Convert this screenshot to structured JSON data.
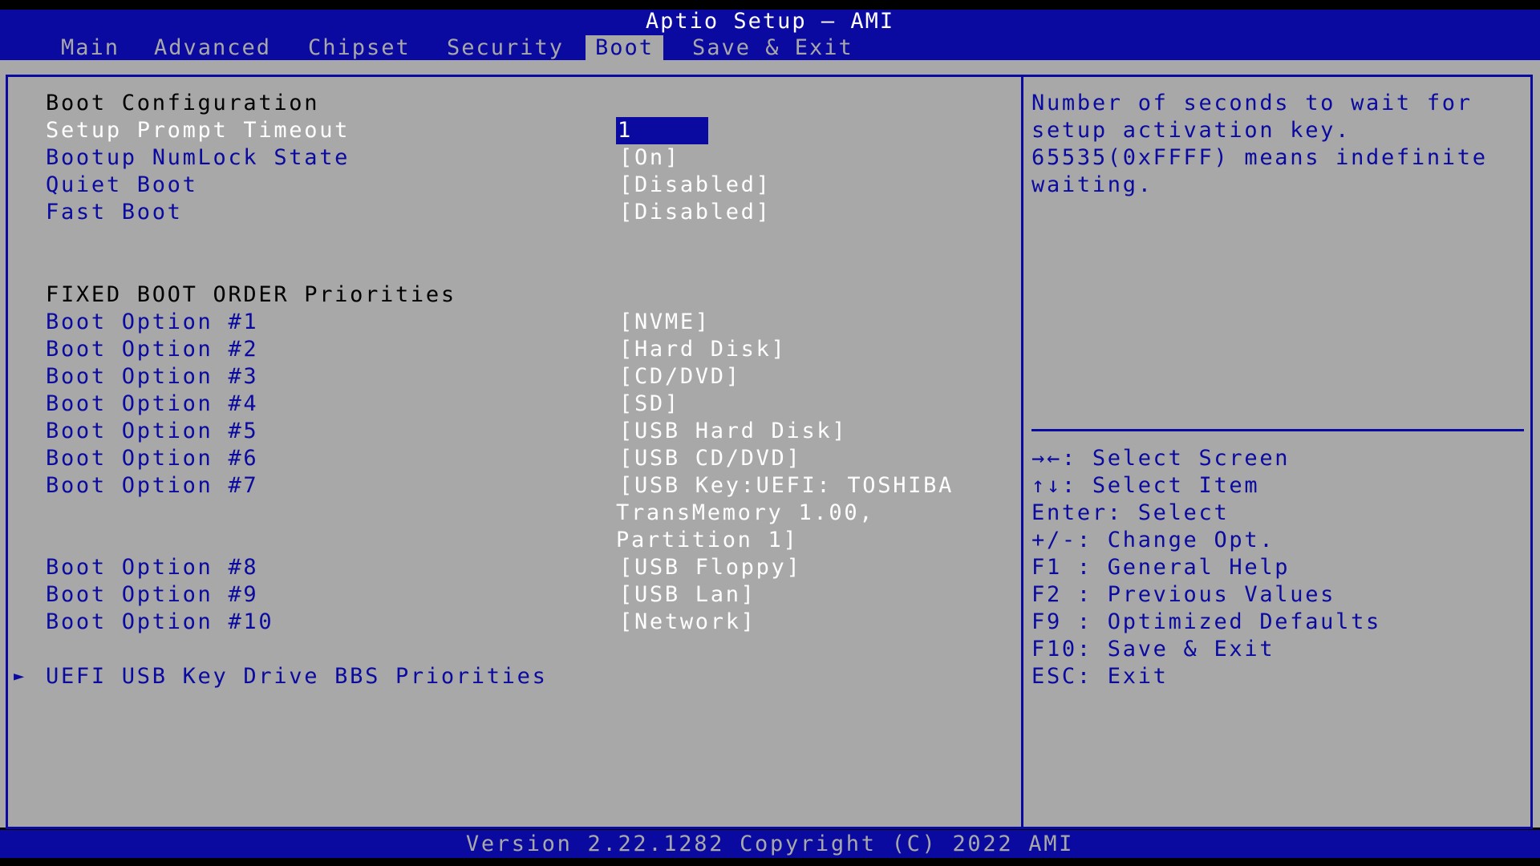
{
  "header": {
    "title": "Aptio Setup – AMI",
    "tabs": [
      {
        "label": "Main"
      },
      {
        "label": "Advanced"
      },
      {
        "label": "Chipset"
      },
      {
        "label": "Security"
      },
      {
        "label": "Boot"
      },
      {
        "label": "Save & Exit"
      }
    ],
    "active_tab": "Boot"
  },
  "settings": {
    "section_boot_config": "Boot Configuration",
    "setup_prompt_timeout": {
      "label": "Setup Prompt Timeout",
      "value": "1"
    },
    "numlock_state": {
      "label": "Bootup NumLock State",
      "value": "[On]"
    },
    "quiet_boot": {
      "label": "Quiet Boot",
      "value": "[Disabled]"
    },
    "fast_boot": {
      "label": "Fast Boot",
      "value": "[Disabled]"
    },
    "section_fixed_boot_order": "FIXED BOOT ORDER Priorities",
    "boot_options": [
      {
        "label": "Boot Option #1",
        "value": "[NVME]"
      },
      {
        "label": "Boot Option #2",
        "value": "[Hard Disk]"
      },
      {
        "label": "Boot Option #3",
        "value": "[CD/DVD]"
      },
      {
        "label": "Boot Option #4",
        "value": "[SD]"
      },
      {
        "label": "Boot Option #5",
        "value": "[USB Hard Disk]"
      },
      {
        "label": "Boot Option #6",
        "value": "[USB CD/DVD]"
      },
      {
        "label": "Boot Option #7",
        "value_lines": [
          "[USB Key:UEFI: TOSHIBA",
          "TransMemory 1.00,",
          "Partition 1]"
        ]
      },
      {
        "label": "Boot Option #8",
        "value": "[USB Floppy]"
      },
      {
        "label": "Boot Option #9",
        "value": "[USB Lan]"
      },
      {
        "label": "Boot Option #10",
        "value": "[Network]"
      }
    ],
    "submenu": {
      "arrow": "►",
      "label": "UEFI USB Key Drive BBS Priorities"
    }
  },
  "help_panel": {
    "description_lines": [
      "Number of seconds to wait for",
      "setup activation key.",
      "65535(0xFFFF) means indefinite",
      "waiting."
    ],
    "key_hints": [
      "→←: Select Screen",
      "↑↓: Select Item",
      "Enter: Select",
      "+/-: Change Opt.",
      "F1 : General Help",
      "F2 : Previous Values",
      "F9 : Optimized Defaults",
      "F10: Save & Exit",
      "ESC: Exit"
    ]
  },
  "footer": {
    "version": "Version 2.22.1282 Copyright (C) 2022 AMI"
  },
  "colors": {
    "bios_blue": "#0a0aa0",
    "bios_gray": "#a8a8a8",
    "text_white": "#ffffff",
    "text_black": "#000000"
  }
}
